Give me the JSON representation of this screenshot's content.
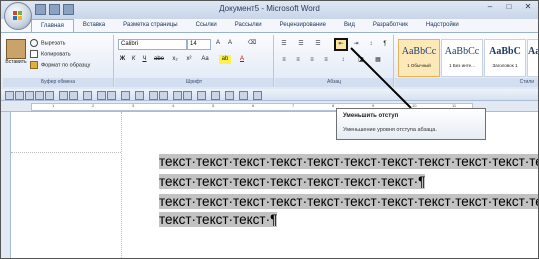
{
  "window": {
    "title": "Документ5 - Microsoft Word"
  },
  "ribbon_tabs": [
    "Главная",
    "Вставка",
    "Разметка страницы",
    "Ссылки",
    "Рассылки",
    "Рецензирование",
    "Вид",
    "Разработчик",
    "Надстройки"
  ],
  "clipboard": {
    "paste_label": "Вставить",
    "cut_label": "Вырезать",
    "copy_label": "Копировать",
    "format_painter_label": "Формат по образцу",
    "group_label": "Буфер обмена"
  },
  "font": {
    "family_value": "Calibri",
    "size_value": "14",
    "group_label": "Шрифт"
  },
  "paragraph": {
    "group_label": "Абзац"
  },
  "styles": {
    "group_label": "Стили",
    "items": [
      {
        "sample": "AaBbCc",
        "name": "1 Обычный"
      },
      {
        "sample": "AaBbCc",
        "name": "1 Без инте..."
      },
      {
        "sample": "AaBbC",
        "name": "Заголовок 1"
      },
      {
        "sample": "AaBbC",
        "name": ""
      }
    ]
  },
  "tooltip": {
    "title": "Уменьшить отступ",
    "description": "Уменьшение уровня отступа абзаца."
  },
  "document": {
    "lines": [
      "текст·текст·текст·текст·текст·текст·текст·текст·текст·текст·те",
      "текст·текст·текст·текст·текст·текст·текст·¶",
      "текст·текст·текст·текст·текст·текст·текст·текст·текст·текст·те",
      "текст·текст·текст·¶"
    ]
  }
}
